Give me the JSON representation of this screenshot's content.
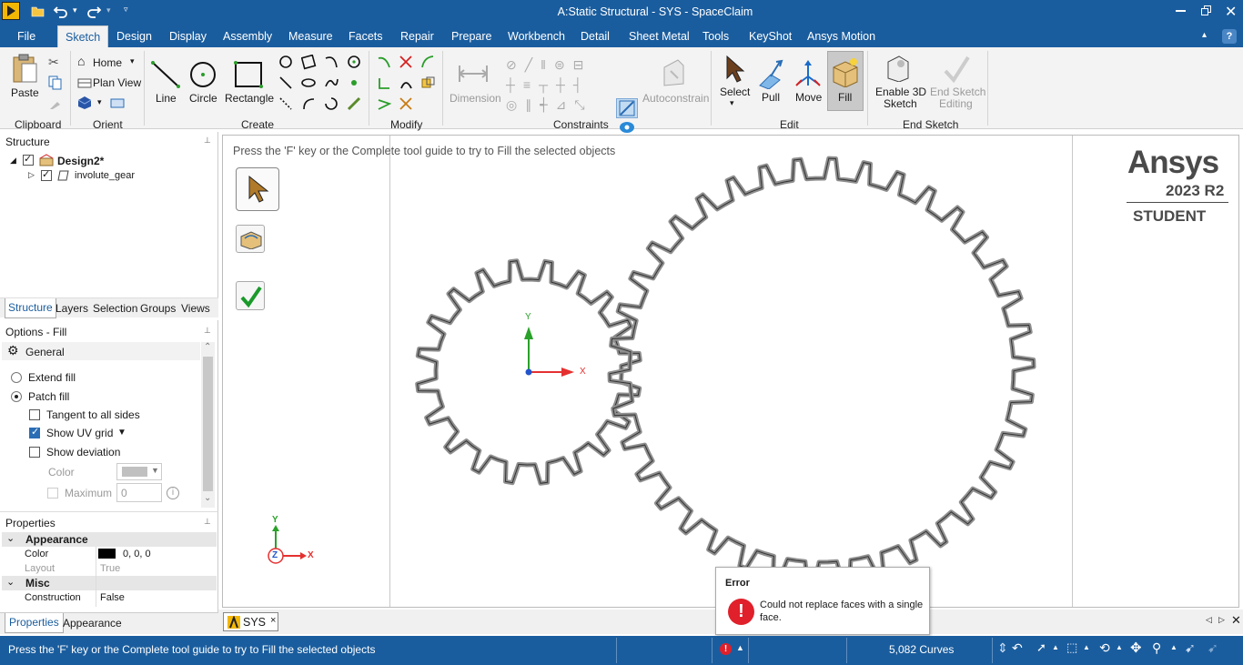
{
  "window": {
    "title": "A:Static Structural - SYS - SpaceClaim"
  },
  "menu": [
    "File",
    "Sketch",
    "Design",
    "Display",
    "Assembly",
    "Measure",
    "Facets",
    "Repair",
    "Prepare",
    "Workbench",
    "Detail",
    "Sheet Metal",
    "Tools",
    "KeyShot",
    "Ansys Motion"
  ],
  "ribbon": {
    "clipboard": {
      "paste": "Paste",
      "group": "Clipboard"
    },
    "orient": {
      "home": "Home",
      "plan_view": "Plan View",
      "group": "Orient"
    },
    "create": {
      "line": "Line",
      "circle": "Circle",
      "rectangle": "Rectangle",
      "group": "Create"
    },
    "modify": {
      "group": "Modify"
    },
    "constraints": {
      "dimension": "Dimension",
      "autoconstrain": "Autoconstrain",
      "group": "Constraints"
    },
    "edit": {
      "select": "Select",
      "pull": "Pull",
      "move": "Move",
      "fill": "Fill",
      "group": "Edit"
    },
    "end_sketch": {
      "enable3d_1": "Enable 3D",
      "enable3d_2": "Sketch",
      "end_1": "End Sketch",
      "end_2": "Editing",
      "group": "End Sketch"
    }
  },
  "structure": {
    "title": "Structure",
    "root": "Design2*",
    "child": "involute_gear"
  },
  "panel_tabs": [
    "Structure",
    "Layers",
    "Selection",
    "Groups",
    "Views"
  ],
  "options": {
    "title": "Options - Fill",
    "section": "General",
    "extend": "Extend fill",
    "patch": "Patch fill",
    "tangent": "Tangent to all sides",
    "uv": "Show UV grid",
    "deviation": "Show deviation",
    "color": "Color",
    "maximum": "Maximum",
    "maximum_value": "0"
  },
  "properties": {
    "title": "Properties",
    "appearance": "Appearance",
    "color_label": "Color",
    "color_value": "0, 0, 0",
    "layout_label": "Layout",
    "layout_value": "True",
    "misc": "Misc",
    "construction_label": "Construction",
    "construction_value": "False"
  },
  "bottom_tabs": [
    "Properties",
    "Appearance"
  ],
  "viewport": {
    "hint": "Press the 'F' key or the Complete tool guide to try to Fill the selected objects",
    "doc_tab": "SYS",
    "axis_x": "X",
    "axis_y": "Y",
    "axis_z": "Z"
  },
  "logo": {
    "brand": "Ansys",
    "version": "2023 R2",
    "edition": "STUDENT"
  },
  "error": {
    "title": "Error",
    "message_1": "Could not replace faces with a single",
    "message_2": "face."
  },
  "status": {
    "text": "Press the 'F' key or the Complete tool guide to try to Fill the selected objects",
    "curves": "5,082 Curves"
  },
  "colors": {
    "accent": "#1a5d9e",
    "axis_x": "#e53030",
    "axis_y": "#2aa12a",
    "axis_z": "#2255cc",
    "error": "#e0202a"
  },
  "gears": {
    "small_teeth": 20,
    "large_teeth": 38
  }
}
